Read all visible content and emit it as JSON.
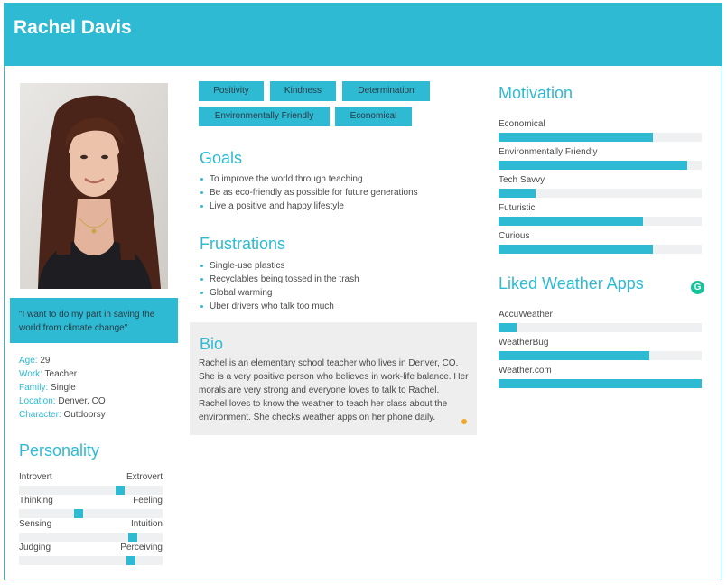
{
  "persona": {
    "name": "Rachel Davis",
    "quote": "\"I want to do my part in saving the world from climate change\""
  },
  "facts": [
    {
      "key": "Age:",
      "value": "29"
    },
    {
      "key": "Work:",
      "value": "Teacher"
    },
    {
      "key": "Family:",
      "value": "Single"
    },
    {
      "key": "Location:",
      "value": "Denver, CO"
    },
    {
      "key": "Character:",
      "value": "Outdoorsy"
    }
  ],
  "personality": {
    "title": "Personality",
    "scales": [
      {
        "left": "Introvert",
        "right": "Extrovert",
        "level": 0.72
      },
      {
        "left": "Thinking",
        "right": "Feeling",
        "level": 0.41
      },
      {
        "left": "Sensing",
        "right": "Intuition",
        "level": 0.81
      },
      {
        "left": "Judging",
        "right": "Perceiving",
        "level": 0.8
      }
    ]
  },
  "tags": [
    "Positivity",
    "Kindness",
    "Determination",
    "Environmentally Friendly",
    "Economical"
  ],
  "goals": {
    "title": "Goals",
    "items": [
      "To improve the world through teaching",
      "Be as eco-friendly as possible for future generations",
      "Live a positive and happy lifestyle"
    ]
  },
  "frustrations": {
    "title": "Frustrations",
    "items": [
      "Single-use plastics",
      "Recyclables being tossed in the trash",
      "Global warming",
      "Uber drivers who talk too much"
    ]
  },
  "bio": {
    "title": "Bio",
    "text": "Rachel is an elementary school teacher who lives in Denver, CO. She is a very positive person who believes in work-life balance. Her morals are very strong and everyone loves to talk to Rachel. Rachel loves to know the weather to teach her class about the environment. She checks weather apps on her phone daily."
  },
  "motivation": {
    "title": "Motivation",
    "items": [
      {
        "label": "Economical",
        "level": 0.76
      },
      {
        "label": "Environmentally Friendly",
        "level": 0.93
      },
      {
        "label": "Tech Savvy",
        "level": 0.18
      },
      {
        "label": "Futuristic",
        "level": 0.71
      },
      {
        "label": "Curious",
        "level": 0.76
      }
    ]
  },
  "liked_apps": {
    "title": "Liked Weather Apps",
    "items": [
      {
        "label": "AccuWeather",
        "level": 0.09
      },
      {
        "label": "WeatherBug",
        "level": 0.74
      },
      {
        "label": "Weather.com",
        "level": 1.0
      }
    ]
  },
  "colors": {
    "accent": "#2ebad3",
    "track": "#eef0f2",
    "bio_bg": "#eeeeee"
  },
  "icons": {
    "grammarly": "grammarly-icon",
    "dot": "orange-dot-icon"
  }
}
